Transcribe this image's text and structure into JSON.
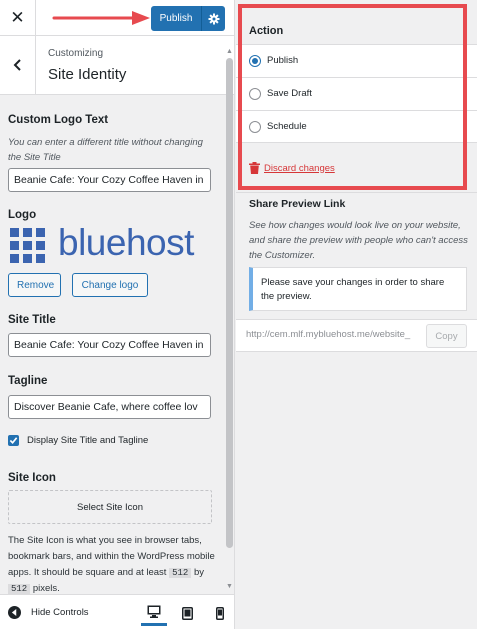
{
  "topbar": {
    "close_glyph": "✕",
    "publish_label": "Publish",
    "settings_icon": "gear-icon"
  },
  "section": {
    "breadcrumb": "Customizing",
    "title": "Site Identity",
    "back_icon": "chevron-left-icon"
  },
  "custom_logo_text": {
    "title": "Custom Logo Text",
    "description": "You can enter a different title without changing the Site Title",
    "value": "Beanie Cafe: Your Cozy Coffee Haven in"
  },
  "logo": {
    "title": "Logo",
    "wordmark": "bluehost",
    "remove_label": "Remove",
    "change_label": "Change logo"
  },
  "site_title": {
    "title": "Site Title",
    "value": "Beanie Cafe: Your Cozy Coffee Haven in"
  },
  "tagline": {
    "title": "Tagline",
    "value": "Discover Beanie Cafe, where coffee lov"
  },
  "display_title_tagline": {
    "label": "Display Site Title and Tagline",
    "checked": true
  },
  "site_icon": {
    "title": "Site Icon",
    "button_label": "Select Site Icon",
    "desc_before": "The Site Icon is what you see in browser tabs, bookmark bars, and within the WordPress mobile apps. It should be square and at least",
    "size_w": "512",
    "by": "by",
    "size_h": "512",
    "desc_after": "pixels."
  },
  "bottombar": {
    "hide_label": "Hide Controls",
    "devices": [
      "desktop",
      "tablet",
      "mobile"
    ],
    "active_device": "desktop"
  },
  "action_panel": {
    "title": "Action",
    "options": [
      {
        "label": "Publish",
        "checked": true
      },
      {
        "label": "Save Draft",
        "checked": false
      },
      {
        "label": "Schedule",
        "checked": false
      }
    ],
    "discard_label": "Discard changes"
  },
  "share": {
    "title": "Share Preview Link",
    "description": "See how changes would look live on your website, and share the preview with people who can't access the Customizer.",
    "notice": "Please save your changes in order to share the preview.",
    "url": "http://cem.mlf.mybluehost.me/website_",
    "copy_label": "Copy"
  },
  "colors": {
    "primary": "#2271b1",
    "danger": "#d63638",
    "highlight": "#e74a4f",
    "logo_blue": "#3b64b0"
  }
}
